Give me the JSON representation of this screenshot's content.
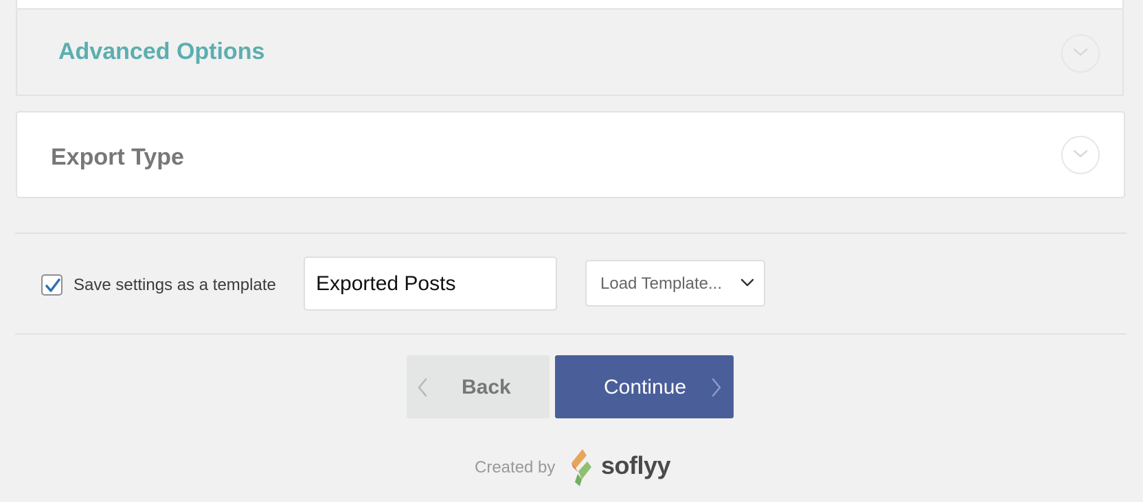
{
  "sections": {
    "advanced_options": {
      "title": "Advanced Options",
      "icon": "chevron-down-icon"
    },
    "export_type": {
      "title": "Export Type",
      "icon": "chevron-down-icon"
    }
  },
  "template": {
    "save_label": "Save settings as a template",
    "save_checked": true,
    "template_name": "Exported Posts",
    "load_template": {
      "selected": "Load Template...",
      "icon": "chevron-down-icon"
    }
  },
  "navigation": {
    "back_label": "Back",
    "continue_label": "Continue",
    "back_icon": "chevron-left-icon",
    "continue_icon": "chevron-right-icon"
  },
  "footer": {
    "created_by": "Created by",
    "brand": "soflyy"
  },
  "colors": {
    "accent_title": "#5caeb0",
    "primary_button": "#4a5e9a",
    "secondary_button": "#e4e5e5",
    "checkbox_check": "#2f6fb3"
  }
}
